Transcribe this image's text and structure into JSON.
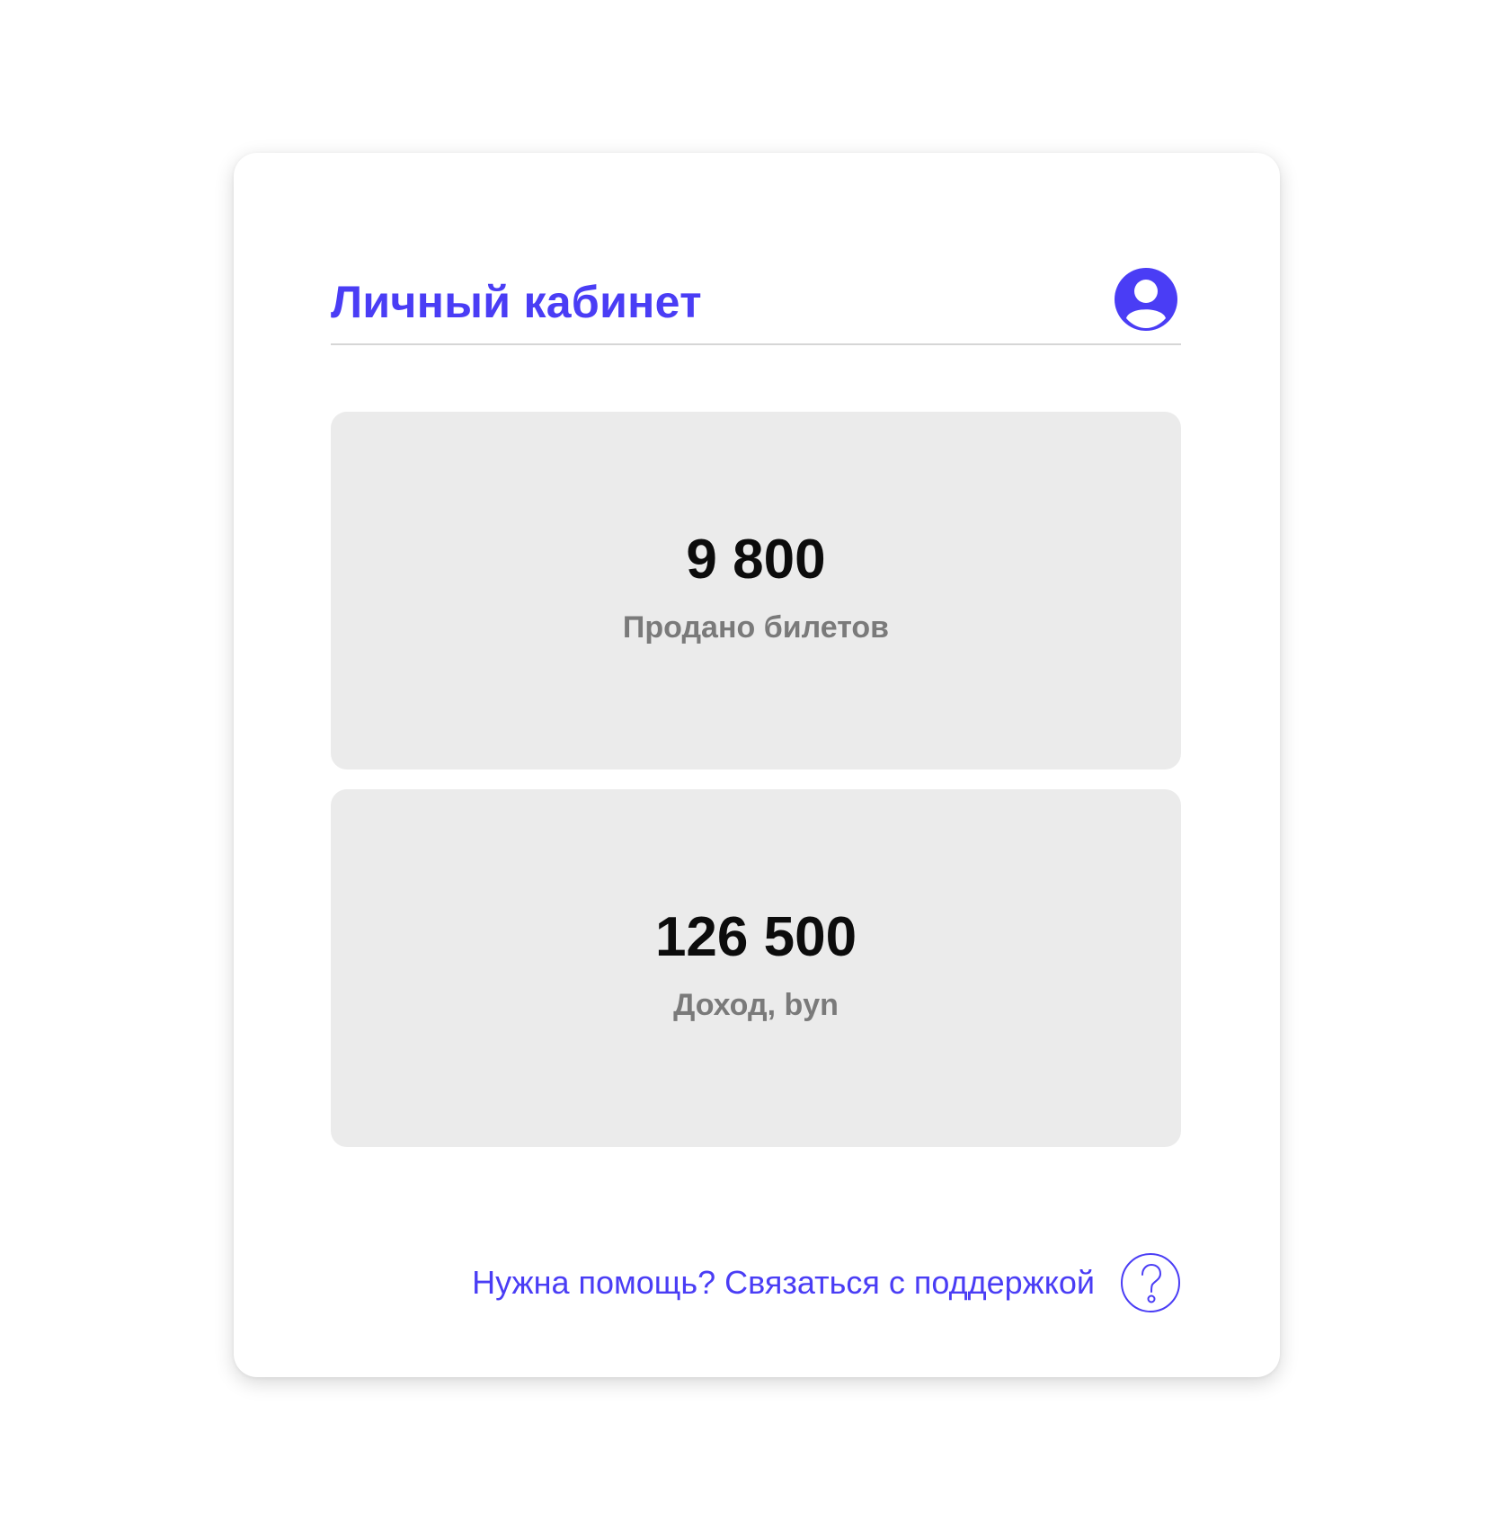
{
  "header": {
    "title": "Личный кабинет",
    "profile_icon": "user-circle-icon"
  },
  "stats": [
    {
      "value": "9 800",
      "label": "Продано билетов"
    },
    {
      "value": "126 500",
      "label": "Доход, byn"
    }
  ],
  "support": {
    "text": "Нужна помощь? Связаться с поддержкой",
    "icon": "question-circle-icon"
  },
  "colors": {
    "accent": "#4a3df5",
    "card_bg": "#ebebeb",
    "label": "#7a7a7a",
    "value": "#0c0c0c"
  }
}
